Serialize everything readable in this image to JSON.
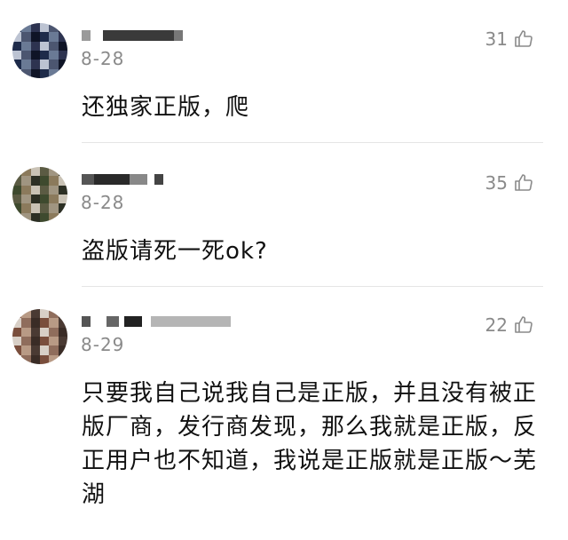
{
  "comments": [
    {
      "date": "8-28",
      "likes": "31",
      "text": "还独家正版，爬",
      "avatar_palette": [
        "#1e2b4a",
        "#6a7a95",
        "#2d3350",
        "#bcc3d2",
        "#4c5670",
        "#0f1426"
      ]
    },
    {
      "date": "8-28",
      "likes": "35",
      "text": "盗版请死一死ok?",
      "avatar_palette": [
        "#3e4a2e",
        "#8b7a5c",
        "#c9c2b5",
        "#5b5b43",
        "#a09581",
        "#2c2f24"
      ]
    },
    {
      "date": "8-29",
      "likes": "22",
      "text": "只要我自己说我自己是正版，并且没有被正版厂商，发行商发现，那么我就是正版，反正用户也不知道，我说是正版就是正版～芜湖",
      "avatar_palette": [
        "#7a4e3c",
        "#b89a85",
        "#4a3a33",
        "#d8cfc6",
        "#8f6d5c",
        "#3a2c26"
      ]
    }
  ],
  "icons": {
    "like": "thumbs-up-icon"
  }
}
